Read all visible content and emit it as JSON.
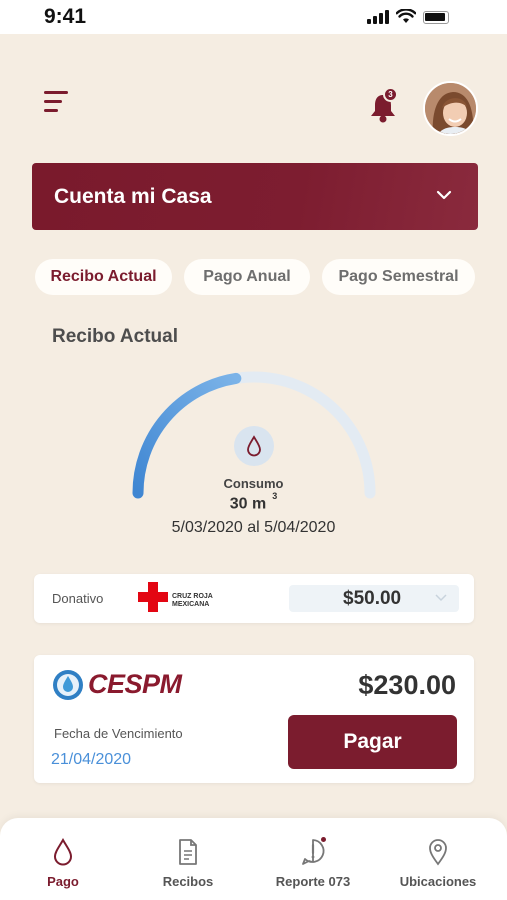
{
  "status_bar": {
    "time": "9:41"
  },
  "header": {
    "notification_count": "3"
  },
  "account": {
    "name": "Cuenta mi Casa"
  },
  "tabs": [
    {
      "label": "Recibo Actual",
      "active": true
    },
    {
      "label": "Pago Anual",
      "active": false
    },
    {
      "label": "Pago Semestral",
      "active": false
    }
  ],
  "current_bill": {
    "title": "Recibo Actual",
    "gauge_fill_fraction": 0.45,
    "consumption_label": "Consumo",
    "consumption_value": "30 m",
    "consumption_unit_exp": "3",
    "period": "5/03/2020 al 5/04/2020"
  },
  "donation": {
    "label": "Donativo",
    "org_name_line1": "CRUZ ROJA",
    "org_name_line2": "MEXICANA",
    "amount": "$50.00"
  },
  "bill": {
    "provider": "CESPM",
    "amount": "$230.00",
    "due_label": "Fecha de Vencimiento",
    "due_date": "21/04/2020",
    "pay_label": "Pagar"
  },
  "bottom_nav": [
    {
      "label": "Pago",
      "icon": "drop-icon",
      "active": true
    },
    {
      "label": "Recibos",
      "icon": "document-icon",
      "active": false
    },
    {
      "label": "Reporte 073",
      "icon": "alert-icon",
      "active": false
    },
    {
      "label": "Ubicaciones",
      "icon": "location-pin-icon",
      "active": false
    }
  ],
  "colors": {
    "brand": "#7b1c2e",
    "background": "#f5ede2",
    "gauge_fill": "#4a90d9",
    "gauge_track": "#e3ebf3",
    "link": "#4a90d9"
  }
}
